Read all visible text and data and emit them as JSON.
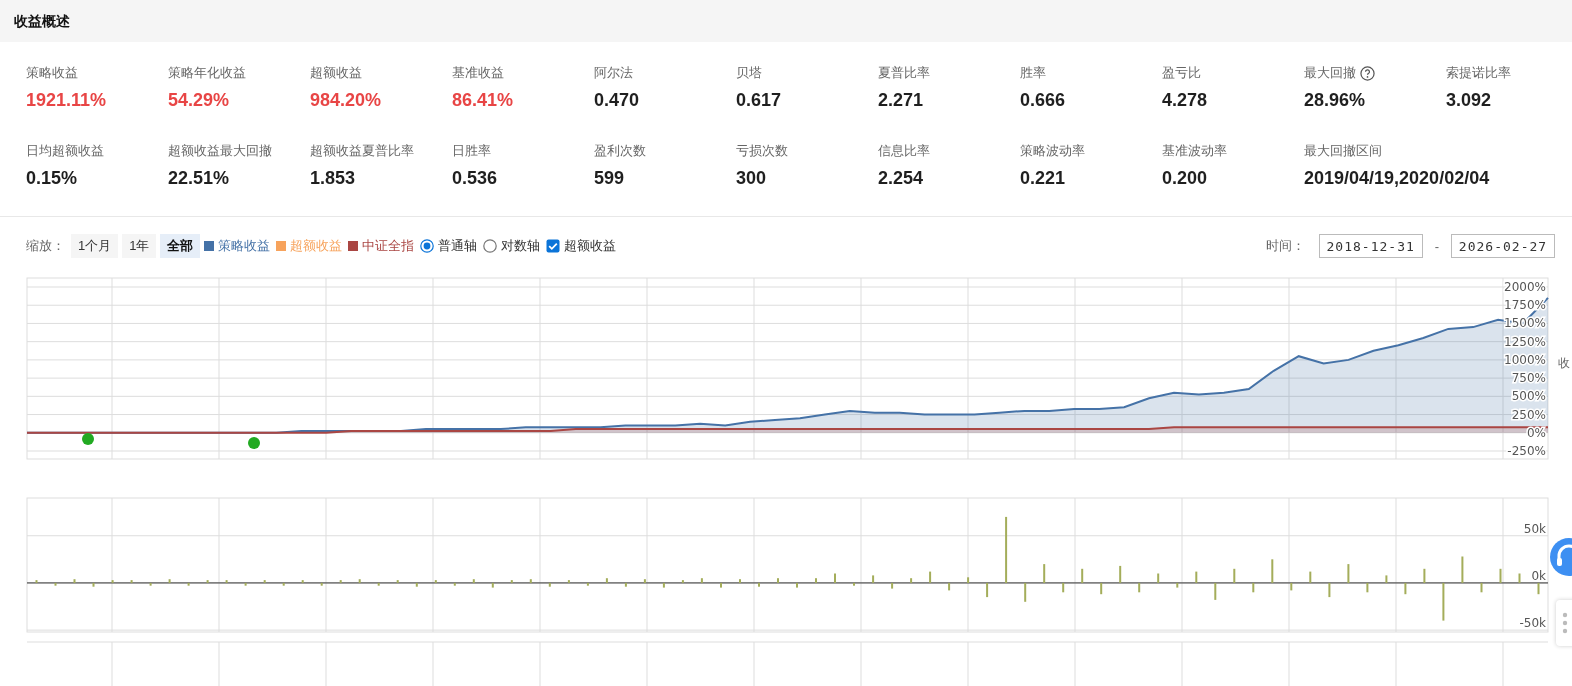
{
  "section": {
    "title": "收益概述"
  },
  "metrics": [
    {
      "label": "策略收益",
      "value": "1921.11%",
      "color": "#e84545",
      "help": false
    },
    {
      "label": "策略年化收益",
      "value": "54.29%",
      "color": "#e84545",
      "help": false
    },
    {
      "label": "超额收益",
      "value": "984.20%",
      "color": "#e84545",
      "help": false
    },
    {
      "label": "基准收益",
      "value": "86.41%",
      "color": "#e84545",
      "help": false
    },
    {
      "label": "阿尔法",
      "value": "0.470",
      "color": "#1f1f1f",
      "help": false
    },
    {
      "label": "贝塔",
      "value": "0.617",
      "color": "#1f1f1f",
      "help": false
    },
    {
      "label": "夏普比率",
      "value": "2.271",
      "color": "#1f1f1f",
      "help": false
    },
    {
      "label": "胜率",
      "value": "0.666",
      "color": "#1f1f1f",
      "help": false
    },
    {
      "label": "盈亏比",
      "value": "4.278",
      "color": "#1f1f1f",
      "help": false
    },
    {
      "label": "最大回撤",
      "value": "28.96%",
      "color": "#1f1f1f",
      "help": true
    },
    {
      "label": "索提诺比率",
      "value": "3.092",
      "color": "#1f1f1f",
      "help": false
    },
    {
      "label": "日均超额收益",
      "value": "0.15%",
      "color": "#1f1f1f",
      "help": false
    },
    {
      "label": "超额收益最大回撤",
      "value": "22.51%",
      "color": "#1f1f1f",
      "help": false
    },
    {
      "label": "超额收益夏普比率",
      "value": "1.853",
      "color": "#1f1f1f",
      "help": false
    },
    {
      "label": "日胜率",
      "value": "0.536",
      "color": "#1f1f1f",
      "help": false
    },
    {
      "label": "盈利次数",
      "value": "599",
      "color": "#1f1f1f",
      "help": false
    },
    {
      "label": "亏损次数",
      "value": "300",
      "color": "#1f1f1f",
      "help": false
    },
    {
      "label": "信息比率",
      "value": "2.254",
      "color": "#1f1f1f",
      "help": false
    },
    {
      "label": "策略波动率",
      "value": "0.221",
      "color": "#1f1f1f",
      "help": false
    },
    {
      "label": "基准波动率",
      "value": "0.200",
      "color": "#1f1f1f",
      "help": false
    },
    {
      "label": "最大回撤区间",
      "value": "2019/04/19,2020/02/04",
      "color": "#1f1f1f",
      "help": false
    }
  ],
  "toolbar": {
    "zoom_label": "缩放：",
    "zoom_buttons": [
      {
        "label": "1个月",
        "selected": false
      },
      {
        "label": "1年",
        "selected": false
      },
      {
        "label": "全部",
        "selected": true
      }
    ],
    "legend": [
      {
        "label": "策略收益",
        "color": "#4572a7"
      },
      {
        "label": "超额收益",
        "color": "#f7a35c"
      },
      {
        "label": "中证全指",
        "color": "#aa4643"
      }
    ],
    "axis_modes": [
      {
        "label": "普通轴",
        "selected": true
      },
      {
        "label": "对数轴",
        "selected": false
      }
    ],
    "excess_toggle": {
      "label": "超额收益",
      "checked": true
    },
    "time_label": "时间：",
    "start_date": "2018-12-31",
    "date_separator": "-",
    "end_date": "2026-02-27"
  },
  "return_chart": {
    "axis_title": "收",
    "chart_data": {
      "type": "area",
      "grid": true,
      "series": [
        {
          "color": "#4572a7",
          "values": [
            0,
            0,
            0,
            0,
            0,
            0,
            0,
            0,
            0,
            0,
            0,
            25,
            25,
            25,
            25,
            25,
            50,
            50,
            50,
            50,
            75,
            75,
            75,
            75,
            100,
            100,
            100,
            125,
            100,
            150,
            175,
            200,
            250,
            300,
            275,
            275,
            250,
            250,
            250,
            275,
            300,
            300,
            325,
            325,
            350,
            475,
            550,
            525,
            550,
            600,
            850,
            1050,
            950,
            1000,
            1125,
            1200,
            1300,
            1425,
            1450,
            1550,
            1500,
            1850
          ]
        },
        {
          "color": "#aa4643",
          "values": [
            0,
            0,
            0,
            0,
            0,
            0,
            0,
            0,
            0,
            0,
            0,
            0,
            0,
            25,
            25,
            25,
            25,
            25,
            25,
            25,
            25,
            25,
            50,
            50,
            50,
            50,
            50,
            50,
            50,
            50,
            50,
            50,
            50,
            50,
            50,
            50,
            50,
            50,
            50,
            50,
            50,
            50,
            50,
            50,
            50,
            50,
            75,
            75,
            75,
            75,
            75,
            75,
            75,
            75,
            75,
            75,
            75,
            75,
            75,
            75,
            75,
            75
          ]
        }
      ],
      "ylim": [
        -250,
        2000
      ],
      "yticks": [
        {
          "value": -250,
          "label": "-250%"
        },
        {
          "value": 0,
          "label": "0%"
        },
        {
          "value": 250,
          "label": "250%"
        },
        {
          "value": 500,
          "label": "500%"
        },
        {
          "value": 750,
          "label": "750%"
        },
        {
          "value": 1000,
          "label": "1000%"
        },
        {
          "value": 1250,
          "label": "1250%"
        },
        {
          "value": 1500,
          "label": "1500%"
        },
        {
          "value": 1750,
          "label": "1750%"
        },
        {
          "value": 2000,
          "label": "2000%"
        }
      ]
    }
  },
  "pnl_chart": {
    "chart_data": {
      "type": "bar",
      "grid": true,
      "series": [
        {
          "color": "#a4ad5a",
          "values": [
            3,
            -3,
            4,
            -4,
            3,
            3,
            -3,
            4,
            -3,
            3,
            3,
            -3,
            3,
            -3,
            3,
            -3,
            3,
            4,
            -3,
            3,
            -4,
            3,
            -3,
            4,
            -5,
            3,
            4,
            -4,
            3,
            -3,
            5,
            -4,
            4,
            -5,
            3,
            5,
            -5,
            4,
            -4,
            5,
            -5,
            5,
            10,
            -3,
            8,
            -6,
            5,
            12,
            -8,
            6,
            -15,
            70,
            -20,
            20,
            -10,
            15,
            -12,
            18,
            -10,
            10,
            -5,
            12,
            -18,
            15,
            -10,
            25,
            -8,
            12,
            -15,
            20,
            -10,
            8,
            -12,
            15,
            -40,
            28,
            -10,
            15,
            10,
            -12
          ]
        }
      ],
      "ylim": [
        -52,
        90
      ],
      "yticks": [
        {
          "value": -50,
          "label": "-50k"
        },
        {
          "value": 0,
          "label": "0k"
        },
        {
          "value": 50,
          "label": "50k"
        }
      ]
    }
  }
}
